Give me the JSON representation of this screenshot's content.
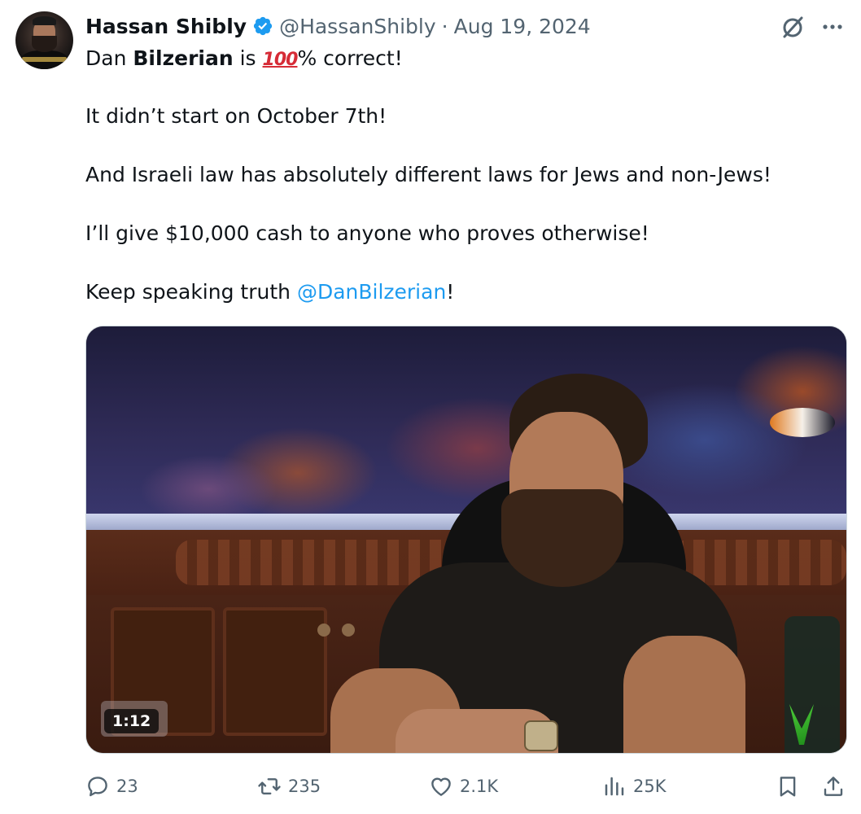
{
  "author": {
    "name": "Hassan Shibly",
    "handle": "@HassanShibly",
    "separator": "·",
    "date": "Aug 19, 2024"
  },
  "tweet": {
    "line1_pre": "Dan ",
    "line1_bold": "Bilzerian",
    "line1_mid": " is ",
    "line1_emoji": "100",
    "line1_post": "% correct!",
    "line2": "It didn’t start on October 7th!",
    "line3": "And Israeli law has absolutely different laws for Jews and non-Jews!",
    "line4": "I’ll give $10,000 cash to anyone who proves otherwise!",
    "line5_pre": "Keep speaking truth ",
    "line5_mention": "@DanBilzerian",
    "line5_post": "!"
  },
  "media": {
    "duration": "1:12"
  },
  "actions": {
    "replies": "23",
    "reposts": "235",
    "likes": "2.1K",
    "views": "25K"
  },
  "colors": {
    "accent": "#1d9bf0",
    "secondary_text": "#536471",
    "text": "#0f1419"
  },
  "icons": [
    "verified-badge-icon",
    "grok-icon",
    "more-icon",
    "reply-icon",
    "repost-icon",
    "like-icon",
    "views-icon",
    "bookmark-icon",
    "share-icon"
  ]
}
